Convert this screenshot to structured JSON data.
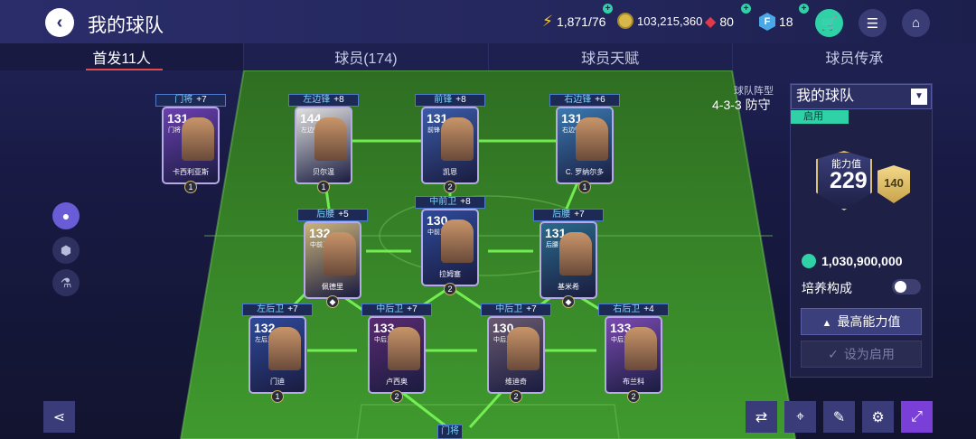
{
  "header": {
    "title": "我的球队",
    "energy": "1,871/76",
    "coins": "103,215,360",
    "gems": "80",
    "fc_points": "18"
  },
  "tabs": [
    {
      "label": "首发11人",
      "active": true
    },
    {
      "label": "球员(174)",
      "active": false
    },
    {
      "label": "球员天赋",
      "active": false
    },
    {
      "label": "球员传承",
      "active": false
    }
  ],
  "formation": {
    "label": "球队阵型",
    "value": "4-3-3 防守"
  },
  "team_panel": {
    "team_name": "我的球队",
    "active_tag": "启用",
    "ability_label": "能力值",
    "ability_value": "229",
    "secondary_value": "140",
    "coin_value": "1,030,900,000",
    "train_label": "培养构成",
    "max_ability_button": "最高能力值",
    "set_active_button": "设为启用"
  },
  "players": [
    {
      "pos": "门将",
      "boost": "+7",
      "ovr": "131",
      "card_pos": "门将",
      "name": "卡西利亚斯",
      "level": "1",
      "color": "#6a3fb0"
    },
    {
      "pos": "左边锋",
      "boost": "+8",
      "ovr": "144",
      "card_pos": "左边锋",
      "name": "贝尔温",
      "level": "1",
      "color": "#e0e0e0"
    },
    {
      "pos": "前锋",
      "boost": "+8",
      "ovr": "131",
      "card_pos": "前锋",
      "name": "凯恩",
      "level": "2",
      "color": "#3a5ba8"
    },
    {
      "pos": "右边锋",
      "boost": "+6",
      "ovr": "131",
      "card_pos": "右边锋",
      "name": "C. 罗纳尔多",
      "level": "1",
      "color": "#3a7ab0"
    },
    {
      "pos": "后腰",
      "boost": "+5",
      "ovr": "132",
      "card_pos": "中前卫",
      "name": "佩德里",
      "level": "",
      "color": "#c9b27a"
    },
    {
      "pos": "中前卫",
      "boost": "+8",
      "ovr": "130",
      "card_pos": "中前卫",
      "name": "拉姆塞",
      "level": "2",
      "color": "#2e4a9a"
    },
    {
      "pos": "后腰",
      "boost": "+7",
      "ovr": "131",
      "card_pos": "后腰",
      "name": "基米希",
      "level": "",
      "color": "#2a6a8a"
    },
    {
      "pos": "左后卫",
      "boost": "+7",
      "ovr": "132",
      "card_pos": "左后卫",
      "name": "门迪",
      "level": "1",
      "color": "#2e4a9a"
    },
    {
      "pos": "中后卫",
      "boost": "+7",
      "ovr": "133",
      "card_pos": "中后卫",
      "name": "卢西奥",
      "level": "2",
      "color": "#5a2a70"
    },
    {
      "pos": "中后卫",
      "boost": "+7",
      "ovr": "130",
      "card_pos": "中后卫",
      "name": "维迪奇",
      "level": "2",
      "color": "#6a5a70"
    },
    {
      "pos": "右后卫",
      "boost": "+4",
      "ovr": "133",
      "card_pos": "中后卫",
      "name": "布兰科",
      "level": "2",
      "color": "#7a4ab0"
    }
  ],
  "goalkeeper_label": "门将",
  "colors": {
    "accent": "#2fd2a6",
    "pitch": "#3f8a2a",
    "panel": "#1e2046"
  }
}
